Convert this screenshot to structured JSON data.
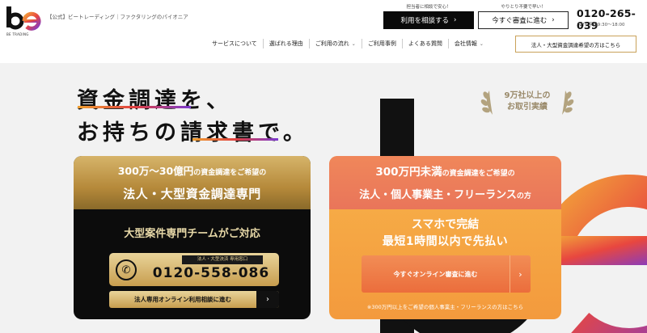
{
  "header": {
    "logo_text": "be",
    "logo_sub": "BE TRADING",
    "tagline": "【公式】ビートレーディング｜ファクタリングのパイオニア",
    "callout_consult": "担当者に相談で安心！",
    "callout_review": "やりとり不要で早い！",
    "btn_consult": "利用を相談する",
    "btn_review": "今すぐ審査に進む",
    "phone": "0120-265-039",
    "hours": "受付 平日9:30〜18:00",
    "nav": [
      {
        "label": "サービスについて",
        "chevron": false
      },
      {
        "label": "選ばれる理由",
        "chevron": false
      },
      {
        "label": "ご利用の流れ",
        "chevron": true
      },
      {
        "label": "ご利用事例",
        "chevron": false
      },
      {
        "label": "よくある質問",
        "chevron": false
      },
      {
        "label": "会社情報",
        "chevron": true
      }
    ],
    "btn_corp": "法人・大型資金調達希望の方はこちら"
  },
  "hero": {
    "line1": "資金調達を、",
    "line2": "お持ちの請求書で。",
    "award_line1": "9万社以上の",
    "award_line2": "お取引実績"
  },
  "card_left": {
    "title1_a": "300万〜30億円",
    "title1_b": "の資金調達をご希望の",
    "title2": "法人・大型資金調達専門",
    "sub": "大型案件専門チームがご対応",
    "phone_label": "法人・大型決済 専用窓口",
    "phone": "0120-558-086",
    "online": "法人専用オンライン利用相談に進む",
    "arrow": "›"
  },
  "card_right": {
    "title1_a": "300万円未満",
    "title1_b": "の資金調達をご希望の",
    "title2_a": "法人・個人事業主・フリーランス",
    "title2_b": "の方",
    "sub1": "スマホで完結",
    "sub2": "最短1時間以内で先払い",
    "btn": "今すぐオンライン審査に進む",
    "arrow": "›",
    "note": "※300万円以上をご希望の個人事業主・フリーランスの方はこちら"
  },
  "colors": {
    "gold": "#c79d4e",
    "orange": "#f39a3d",
    "coral": "#e9755a",
    "black": "#0c0c0c"
  }
}
